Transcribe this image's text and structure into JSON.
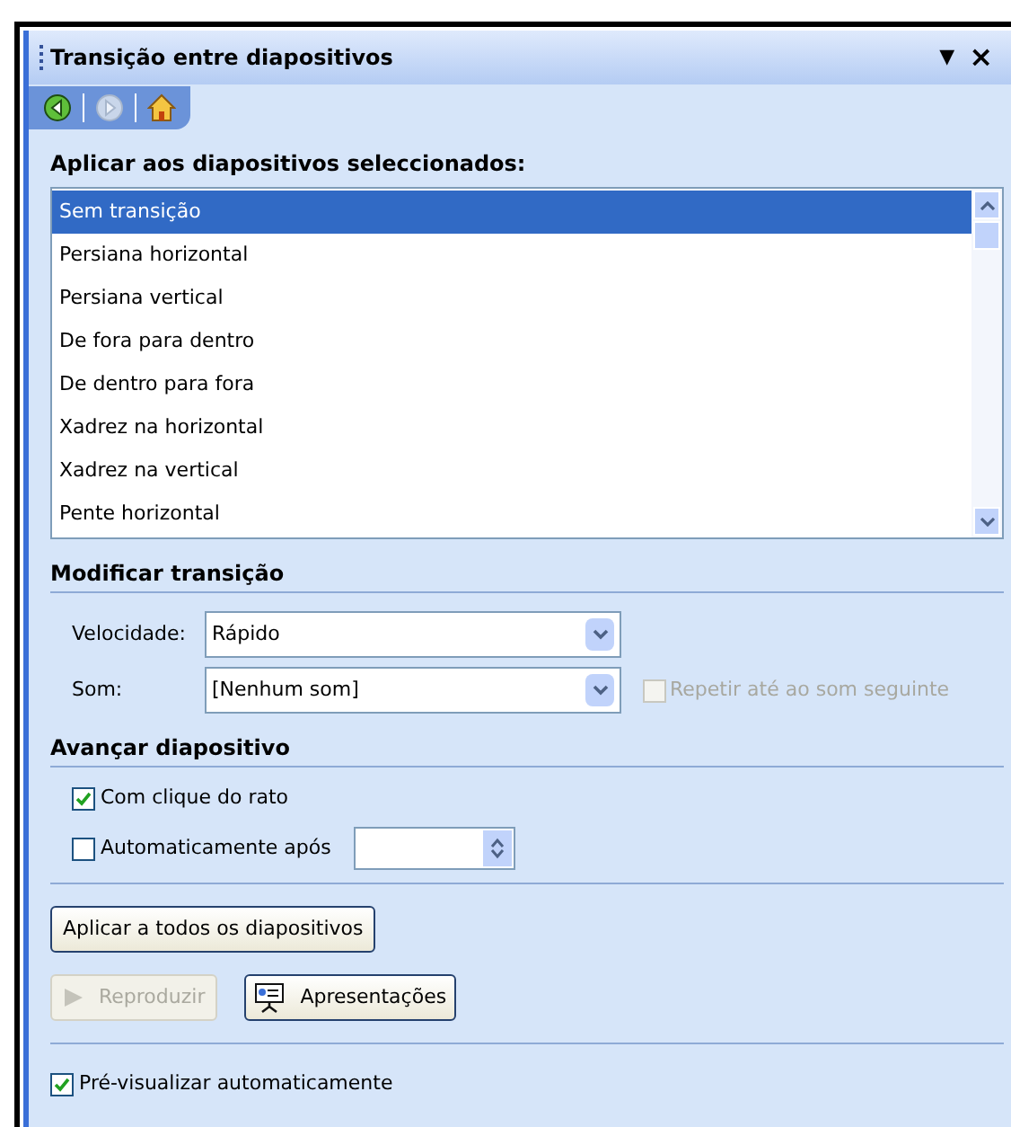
{
  "pane": {
    "title": "Transição entre diapositivos",
    "menu_glyph": "▼",
    "close_glyph": "×"
  },
  "nav": [
    {
      "kind": "back",
      "disabled": false
    },
    {
      "kind": "forward",
      "disabled": true
    },
    {
      "kind": "home",
      "disabled": false
    }
  ],
  "apply_section": {
    "heading": "Aplicar aos diapositivos seleccionados:",
    "items": [
      {
        "label": "Sem transição",
        "selected": true
      },
      {
        "label": "Persiana horizontal",
        "selected": false
      },
      {
        "label": "Persiana vertical",
        "selected": false
      },
      {
        "label": "De fora para dentro",
        "selected": false
      },
      {
        "label": "De dentro para fora",
        "selected": false
      },
      {
        "label": "Xadrez na horizontal",
        "selected": false
      },
      {
        "label": "Xadrez na vertical",
        "selected": false
      },
      {
        "label": "Pente horizontal",
        "selected": false
      }
    ]
  },
  "modify_section": {
    "heading": "Modificar transição",
    "speed": {
      "label": "Velocidade:",
      "value": "Rápido"
    },
    "sound": {
      "label": "Som:",
      "value": "[Nenhum som]"
    },
    "loop": {
      "label": "Repetir até ao som seguinte",
      "checked": false,
      "disabled": true
    }
  },
  "advance_section": {
    "heading": "Avançar diapositivo",
    "options": [
      {
        "kind": "checkbox",
        "label": "Com clique do rato",
        "checked": true
      },
      {
        "kind": "timer",
        "label": "Automaticamente após",
        "checked": false
      }
    ]
  },
  "buttons": [
    {
      "kind": "apply_all",
      "label": "Aplicar a todos os diapositivos"
    },
    {
      "kind": "play",
      "label": "Reproduzir",
      "disabled": true
    },
    {
      "kind": "slideshow",
      "label": "Apresentações"
    }
  ],
  "autopreview": {
    "label": "Pré-visualizar automaticamente",
    "checked": true
  }
}
